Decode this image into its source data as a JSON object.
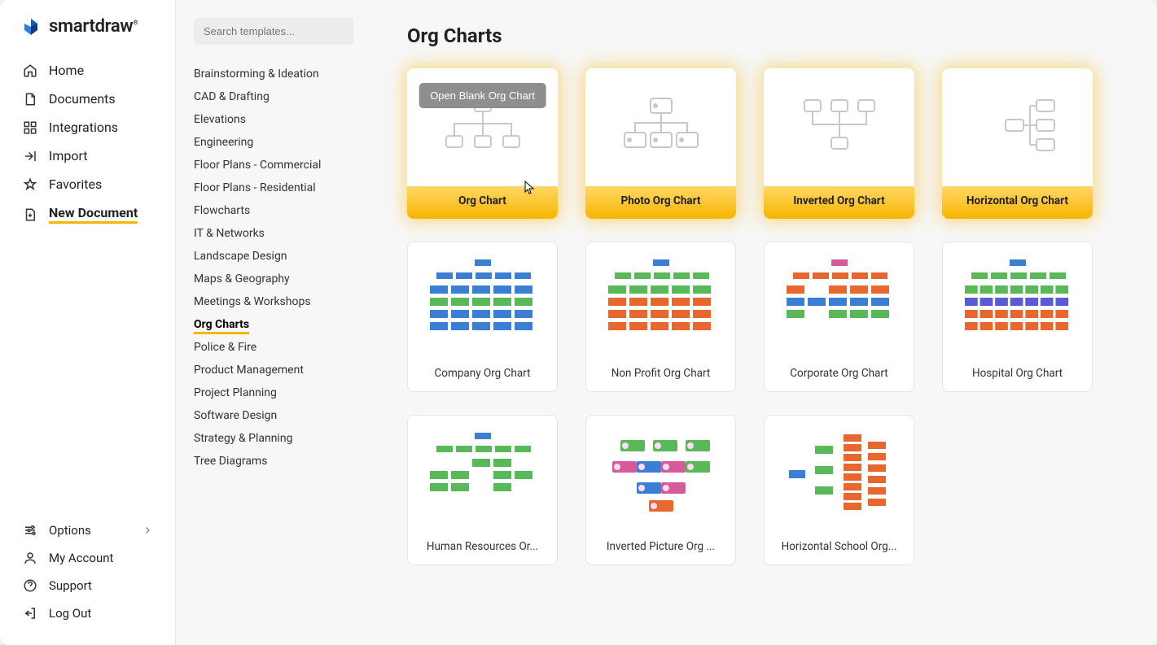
{
  "brand": {
    "name": "smartdraw"
  },
  "nav": {
    "items": [
      {
        "label": "Home",
        "icon": "home"
      },
      {
        "label": "Documents",
        "icon": "document"
      },
      {
        "label": "Integrations",
        "icon": "integrations"
      },
      {
        "label": "Import",
        "icon": "import"
      },
      {
        "label": "Favorites",
        "icon": "star"
      },
      {
        "label": "New Document",
        "icon": "new-doc",
        "active": true
      }
    ],
    "bottom": [
      {
        "label": "Options",
        "icon": "options",
        "chevron": true
      },
      {
        "label": "My Account",
        "icon": "account"
      },
      {
        "label": "Support",
        "icon": "support"
      },
      {
        "label": "Log Out",
        "icon": "logout"
      }
    ]
  },
  "search": {
    "placeholder": "Search templates..."
  },
  "categories": [
    "Brainstorming & Ideation",
    "CAD & Drafting",
    "Elevations",
    "Engineering",
    "Floor Plans - Commercial",
    "Floor Plans - Residential",
    "Flowcharts",
    "IT & Networks",
    "Landscape Design",
    "Maps & Geography",
    "Meetings & Workshops",
    "Org Charts",
    "Police & Fire",
    "Product Management",
    "Project Planning",
    "Software Design",
    "Strategy & Planning",
    "Tree Diagrams"
  ],
  "selected_category_index": 11,
  "page_title": "Org Charts",
  "hover_button_label": "Open Blank Org Chart",
  "templates": {
    "featured": [
      {
        "label": "Org Chart"
      },
      {
        "label": "Photo Org Chart"
      },
      {
        "label": "Inverted Org Chart"
      },
      {
        "label": "Horizontal Org Chart"
      }
    ],
    "regular": [
      {
        "label": "Company Org Chart"
      },
      {
        "label": "Non Profit Org Chart"
      },
      {
        "label": "Corporate Org Chart"
      },
      {
        "label": "Hospital Org Chart"
      },
      {
        "label": "Human Resources Or..."
      },
      {
        "label": "Inverted Picture Org ..."
      },
      {
        "label": "Horizontal School Org..."
      }
    ]
  }
}
